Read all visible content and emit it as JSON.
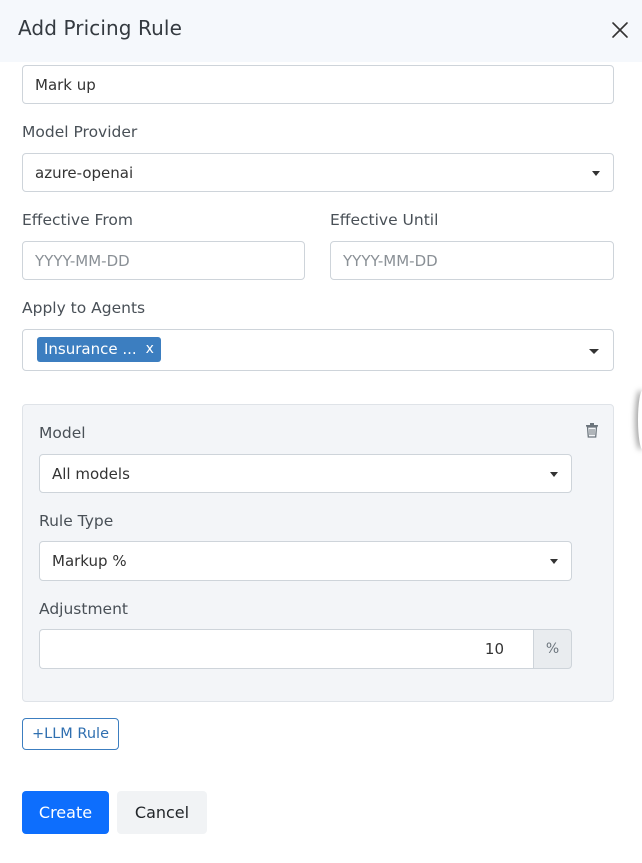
{
  "modal": {
    "title": "Add Pricing Rule"
  },
  "form": {
    "rule_name": {
      "value": "Mark up"
    },
    "model_provider": {
      "label": "Model Provider",
      "value": "azure-openai"
    },
    "effective_from": {
      "label": "Effective From",
      "placeholder": "YYYY-MM-DD"
    },
    "effective_until": {
      "label": "Effective Until",
      "placeholder": "YYYY-MM-DD"
    },
    "apply_to_agents": {
      "label": "Apply to Agents",
      "selected_tags": [
        {
          "text": "Insurance ...",
          "remove": "x"
        }
      ]
    }
  },
  "llm_rule": {
    "model": {
      "label": "Model",
      "value": "All models"
    },
    "rule_type": {
      "label": "Rule Type",
      "value": "Markup %"
    },
    "adjustment": {
      "label": "Adjustment",
      "value": "10",
      "suffix": "%"
    }
  },
  "actions": {
    "add_llm_rule": "+LLM Rule",
    "create": "Create",
    "cancel": "Cancel"
  },
  "colors": {
    "primary": "#0d6efd",
    "tag": "#3c7ec0",
    "header_bg": "#f5f8fc",
    "card_bg": "#f3f5f8"
  },
  "icons": {
    "close": "close-icon",
    "caret": "caret-down-icon",
    "delete": "trash-icon"
  }
}
